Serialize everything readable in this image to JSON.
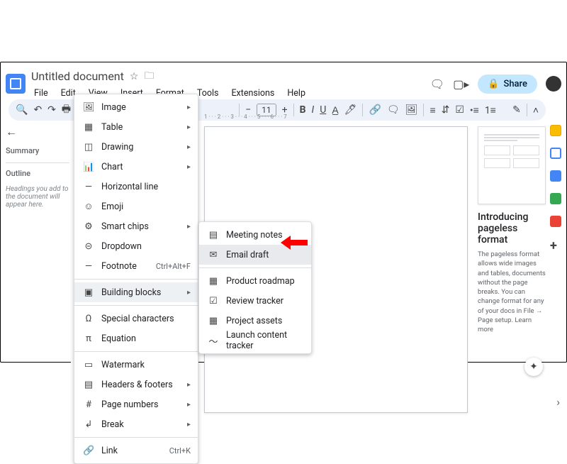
{
  "header": {
    "title": "Untitled document",
    "menus": [
      "File",
      "Edit",
      "View",
      "Insert",
      "Format",
      "Tools",
      "Extensions",
      "Help"
    ],
    "share_label": "Share"
  },
  "toolbar": {
    "font_size": "11",
    "bold": "B",
    "italic": "I",
    "underline": "U"
  },
  "left_panel": {
    "summary": "Summary",
    "outline": "Outline",
    "empty_note": "Headings you add to the document will appear here."
  },
  "insert_menu": {
    "items": [
      {
        "icon": "🖼",
        "label": "Image",
        "submenu": true
      },
      {
        "icon": "▦",
        "label": "Table",
        "submenu": true
      },
      {
        "icon": "◫",
        "label": "Drawing",
        "submenu": true
      },
      {
        "icon": "📊",
        "label": "Chart",
        "submenu": true
      },
      {
        "icon": "—",
        "label": "Horizontal line"
      },
      {
        "icon": "☺",
        "label": "Emoji"
      },
      {
        "icon": "⚙",
        "label": "Smart chips",
        "submenu": true
      },
      {
        "icon": "⊝",
        "label": "Dropdown"
      },
      {
        "icon": "—",
        "label": "Footnote",
        "shortcut": "Ctrl+Alt+F"
      }
    ],
    "building_blocks": {
      "icon": "▣",
      "label": "Building blocks",
      "submenu": true
    },
    "items2": [
      {
        "icon": "Ω",
        "label": "Special characters"
      },
      {
        "icon": "π",
        "label": "Equation"
      }
    ],
    "items3": [
      {
        "icon": "▭",
        "label": "Watermark"
      },
      {
        "icon": "▤",
        "label": "Headers & footers",
        "submenu": true
      },
      {
        "icon": "#",
        "label": "Page numbers",
        "submenu": true
      },
      {
        "icon": "↲",
        "label": "Break",
        "submenu": true
      }
    ],
    "link": {
      "icon": "🔗",
      "label": "Link",
      "shortcut": "Ctrl+K"
    }
  },
  "building_blocks_submenu": {
    "items": [
      {
        "icon": "▤",
        "label": "Meeting notes"
      },
      {
        "icon": "✉",
        "label": "Email draft",
        "highlighted": true
      }
    ],
    "items2": [
      {
        "icon": "▦",
        "label": "Product roadmap"
      },
      {
        "icon": "☑",
        "label": "Review tracker"
      },
      {
        "icon": "▦",
        "label": "Project assets"
      },
      {
        "icon": "〜",
        "label": "Launch content tracker"
      }
    ]
  },
  "right_panel": {
    "title": "Introducing pageless format",
    "body": "The pageless format allows wide images and tables, documents without the page breaks. You can change format for any of your docs in File → Page setup. Learn more"
  },
  "ruler_ticks": "1 · · · 2 · · · 3 · · · 4 · · · 5 · · · 6 · · · 7"
}
